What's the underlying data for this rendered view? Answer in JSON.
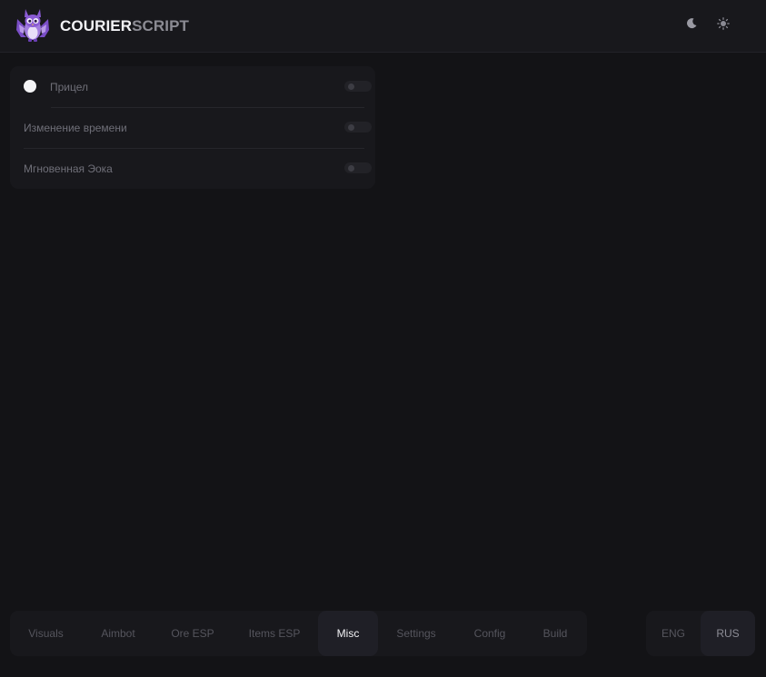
{
  "header": {
    "brand_bold": "COURIER",
    "brand_light": "SCRIPT",
    "theme_buttons": [
      {
        "name": "moon-icon",
        "active": true
      },
      {
        "name": "sun-icon",
        "active": false
      }
    ]
  },
  "misc_panel": {
    "rows": [
      {
        "label": "Прицел",
        "enabled": false
      },
      {
        "label": "Изменение времени",
        "enabled": false
      },
      {
        "label": "Мгновенная Эока",
        "enabled": false
      }
    ]
  },
  "tabs": {
    "items": [
      {
        "label": "Visuals"
      },
      {
        "label": "Aimbot"
      },
      {
        "label": "Ore ESP"
      },
      {
        "label": "Items ESP"
      },
      {
        "label": "Misc"
      },
      {
        "label": "Settings"
      },
      {
        "label": "Config"
      },
      {
        "label": "Build"
      }
    ],
    "active": "Misc"
  },
  "language": {
    "options": [
      {
        "label": "ENG"
      },
      {
        "label": "RUS"
      }
    ],
    "active": "RUS"
  },
  "colors": {
    "background": "#131316",
    "panel": "#18181c",
    "active_tab": "#1f1f26",
    "logo_purple": "#8a5bd4"
  }
}
